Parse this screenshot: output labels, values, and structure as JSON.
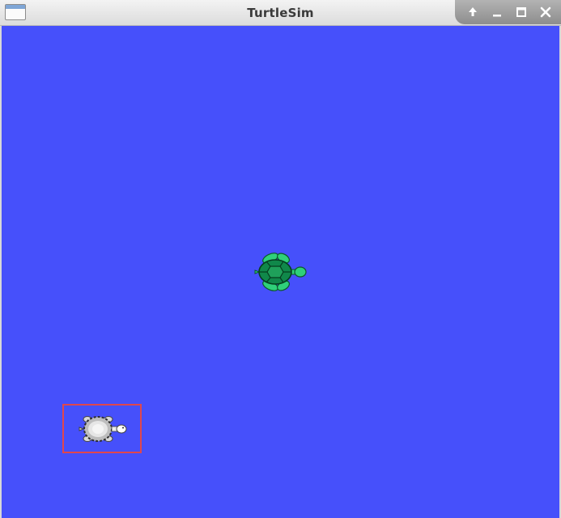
{
  "window": {
    "title": "TurtleSim",
    "app_icon": "window-icon",
    "controls": [
      "up-arrow-icon",
      "minimize-icon",
      "maximize-icon",
      "close-icon"
    ]
  },
  "canvas": {
    "background_color": "#4650fb",
    "turtles": [
      {
        "name": "green-turtle",
        "color": "#19a04c",
        "heading": "east"
      },
      {
        "name": "gray-turtle",
        "color": "#bfbfbf",
        "heading": "east",
        "highlighted": true
      }
    ],
    "highlight_color": "#e0474c"
  }
}
